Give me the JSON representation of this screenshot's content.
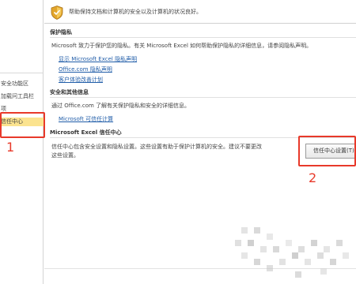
{
  "sidebar": {
    "items": [
      {
        "label": "安全功能区"
      },
      {
        "label": "加载问工具栏"
      },
      {
        "label": "项"
      },
      {
        "label": "信任中心"
      }
    ]
  },
  "header": {
    "text": "帮助保持文档和计算机的安全以及计算机的状况良好。"
  },
  "privacy": {
    "title": "保护隐私",
    "description": "Microsoft 致力于保护您的隐私。有关 Microsoft Excel 如何帮助保护隐私的详细信息，请参阅隐私声明。",
    "links": [
      "显示 Microsoft Excel 隐私声明",
      "Office.com 隐私声明",
      "客户体验改善计划"
    ]
  },
  "security_more": {
    "title": "安全和其他信息",
    "description": "通过 Office.com 了解有关保护隐私和安全的详细信息。",
    "link": "Microsoft 可信任计算"
  },
  "trust_center": {
    "title": "Microsoft Excel 信任中心",
    "description_line1": "信任中心包含安全设置和隐私设置。这些设置有助于保护计算机的安全。建议不要更改",
    "description_line2": "这些设置。",
    "button_label": "信任中心设置(T)..."
  },
  "annotations": {
    "step1": "1",
    "step2": "2"
  },
  "colors": {
    "selected_bg": "#fbe38f",
    "link": "#1f5ca8",
    "annotation": "#e8392a"
  }
}
